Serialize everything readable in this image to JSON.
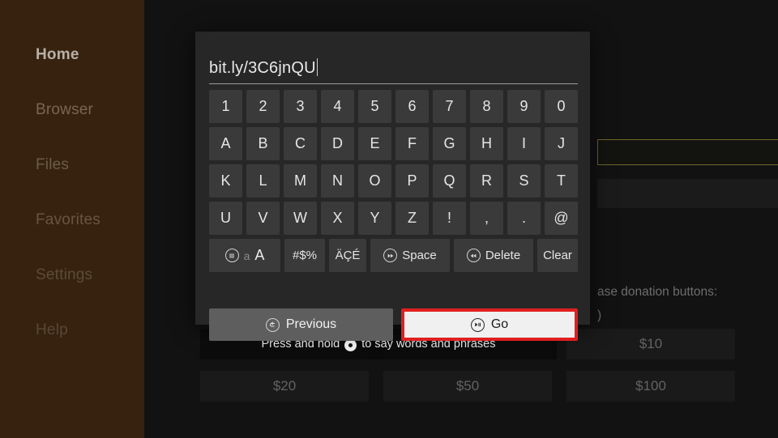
{
  "sidebar": {
    "items": [
      {
        "label": "Home",
        "active": true
      },
      {
        "label": "Browser",
        "active": false
      },
      {
        "label": "Files",
        "active": false
      },
      {
        "label": "Favorites",
        "active": false
      },
      {
        "label": "Settings",
        "active": false
      },
      {
        "label": "Help",
        "active": false
      }
    ]
  },
  "background": {
    "donation_heading": "ase donation buttons:",
    "donation_subtext": ")",
    "donation_buttons": [
      "$10",
      "$20",
      "$50",
      "$100"
    ],
    "voice_hint_before": "Press and hold",
    "voice_hint_after": "to say words and phrases",
    "voice_icon": "mic-icon"
  },
  "keyboard": {
    "input_value": "bit.ly/3C6jnQU",
    "input_placeholder": "",
    "rows": [
      [
        "1",
        "2",
        "3",
        "4",
        "5",
        "6",
        "7",
        "8",
        "9",
        "0"
      ],
      [
        "A",
        "B",
        "C",
        "D",
        "E",
        "F",
        "G",
        "H",
        "I",
        "J"
      ],
      [
        "K",
        "L",
        "M",
        "N",
        "O",
        "P",
        "Q",
        "R",
        "S",
        "T"
      ],
      [
        "U",
        "V",
        "W",
        "X",
        "Y",
        "Z",
        "!",
        ",",
        ".",
        "@"
      ]
    ],
    "function_keys": {
      "shift_lower": "a",
      "shift_upper": "A",
      "shift_icon": "menu-circle-icon",
      "symbols": "#$%",
      "accents": "ÄÇÉ",
      "space": "Space",
      "space_icon": "fast-forward-circle-icon",
      "delete": "Delete",
      "delete_icon": "rewind-circle-icon",
      "clear": "Clear"
    },
    "actions": {
      "previous": "Previous",
      "previous_icon": "back-arrow-circle-icon",
      "go": "Go",
      "go_icon": "play-pause-circle-icon"
    }
  },
  "colors": {
    "sidebar_bg": "#37220f",
    "content_bg": "#121212",
    "dialog_bg": "#272727",
    "key_bg": "#3a3a3a",
    "focus_red": "#e01f1f",
    "go_bg": "#f0f0f0",
    "outline_yellow": "#6e6a2a"
  }
}
